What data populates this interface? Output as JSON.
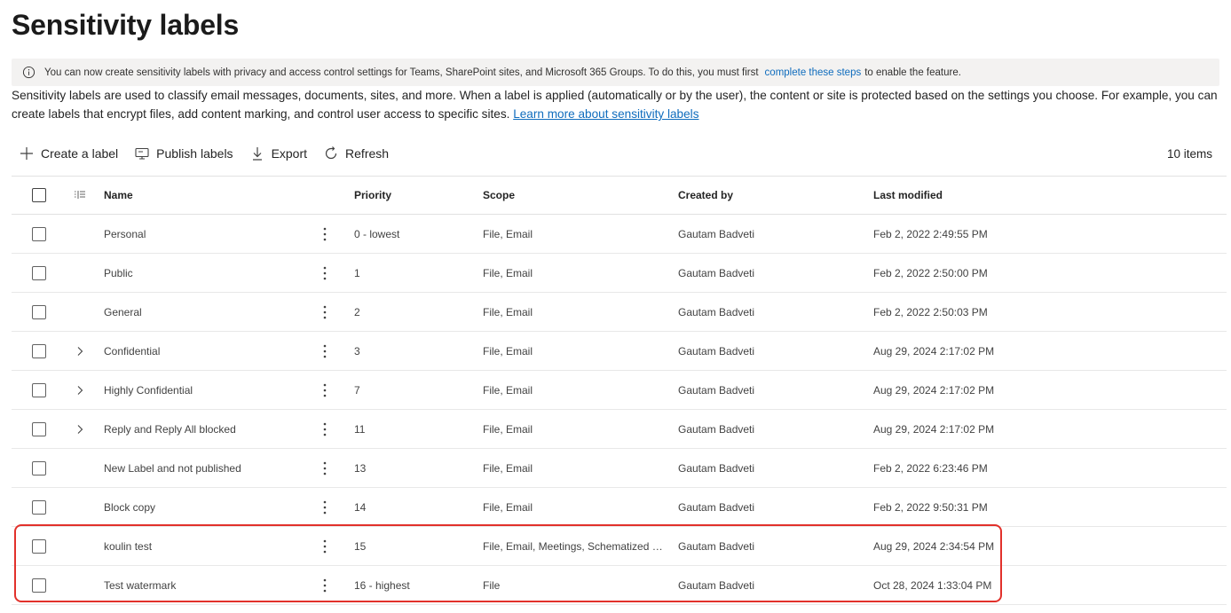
{
  "page": {
    "title": "Sensitivity labels"
  },
  "banner": {
    "text": "You can now create sensitivity labels with privacy and access control settings for Teams, SharePoint sites, and Microsoft 365 Groups. To do this, you must first",
    "link": "complete these steps",
    "suffix": "to enable the feature."
  },
  "description": {
    "text": "Sensitivity labels are used to classify email messages, documents, sites, and more. When a label is applied (automatically or by the user), the content or site is protected based on the settings you choose. For example, you can create labels that encrypt files, add content marking, and control user access to specific sites. ",
    "link": "Learn more about sensitivity labels"
  },
  "toolbar": {
    "create": "Create a label",
    "publish": "Publish labels",
    "export": "Export",
    "refresh": "Refresh",
    "count": "10 items"
  },
  "columns": {
    "name": "Name",
    "priority": "Priority",
    "scope": "Scope",
    "created_by": "Created by",
    "last_modified": "Last modified"
  },
  "rows": [
    {
      "name": "Personal",
      "priority": "0 - lowest",
      "scope": "File, Email",
      "created_by": "Gautam Badveti",
      "modified": "Feb 2, 2022 2:49:55 PM",
      "expandable": false
    },
    {
      "name": "Public",
      "priority": "1",
      "scope": "File, Email",
      "created_by": "Gautam Badveti",
      "modified": "Feb 2, 2022 2:50:00 PM",
      "expandable": false
    },
    {
      "name": "General",
      "priority": "2",
      "scope": "File, Email",
      "created_by": "Gautam Badveti",
      "modified": "Feb 2, 2022 2:50:03 PM",
      "expandable": false
    },
    {
      "name": "Confidential",
      "priority": "3",
      "scope": "File, Email",
      "created_by": "Gautam Badveti",
      "modified": "Aug 29, 2024 2:17:02 PM",
      "expandable": true
    },
    {
      "name": "Highly Confidential",
      "priority": "7",
      "scope": "File, Email",
      "created_by": "Gautam Badveti",
      "modified": "Aug 29, 2024 2:17:02 PM",
      "expandable": true
    },
    {
      "name": "Reply and Reply All blocked",
      "priority": "11",
      "scope": "File, Email",
      "created_by": "Gautam Badveti",
      "modified": "Aug 29, 2024 2:17:02 PM",
      "expandable": true
    },
    {
      "name": "New Label and not published",
      "priority": "13",
      "scope": "File, Email",
      "created_by": "Gautam Badveti",
      "modified": "Feb 2, 2022 6:23:46 PM",
      "expandable": false
    },
    {
      "name": "Block copy",
      "priority": "14",
      "scope": "File, Email",
      "created_by": "Gautam Badveti",
      "modified": "Feb 2, 2022 9:50:31 PM",
      "expandable": false
    },
    {
      "name": "koulin test",
      "priority": "15",
      "scope": "File, Email, Meetings, Schematized d...",
      "created_by": "Gautam Badveti",
      "modified": "Aug 29, 2024 2:34:54 PM",
      "expandable": false
    },
    {
      "name": "Test watermark",
      "priority": "16 - highest",
      "scope": "File",
      "created_by": "Gautam Badveti",
      "modified": "Oct 28, 2024 1:33:04 PM",
      "expandable": false
    }
  ],
  "colors": {
    "link": "#0f6cbd",
    "highlight": "#e2312b",
    "banner_bg": "#f3f2f1"
  }
}
